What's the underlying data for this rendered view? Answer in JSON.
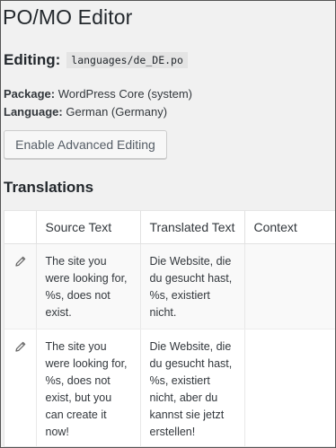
{
  "header": {
    "title": "PO/MO Editor"
  },
  "editing": {
    "label": "Editing:",
    "file": "languages/de_DE.po"
  },
  "meta": {
    "package_label": "Package:",
    "package_value": "WordPress Core (system)",
    "language_label": "Language:",
    "language_value": "German (Germany)"
  },
  "actions": {
    "advanced_label": "Enable Advanced Editing"
  },
  "translations": {
    "title": "Translations",
    "columns": {
      "icon": "",
      "source": "Source Text",
      "translated": "Translated Text",
      "context": "Context"
    },
    "rows": [
      {
        "icon": "pencil-icon",
        "source": "The site you were looking for, %s, does not exist.",
        "translated": "Die Website, die du gesucht hast, %s, existiert nicht.",
        "context": ""
      },
      {
        "icon": "pencil-icon",
        "source": "The site you were looking for, %s, does not exist, but you can create it now!",
        "translated": "Die Website, die du gesucht hast, %s, existiert nicht, aber du kannst sie jetzt erstellen!",
        "context": ""
      }
    ]
  },
  "colors": {
    "background": "#f1f1f1",
    "table_bg": "#ffffff",
    "alt_row": "#f9f9f9",
    "text": "#23282d"
  }
}
